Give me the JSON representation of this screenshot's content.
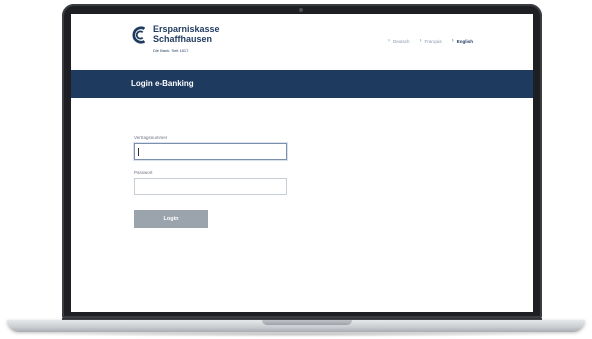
{
  "brand": {
    "name_line1": "Ersparniskasse",
    "name_line2": "Schaffhausen",
    "tagline": "Die Bank. Seit 1817."
  },
  "languages": [
    {
      "label": "Deutsch",
      "active": false
    },
    {
      "label": "Français",
      "active": false
    },
    {
      "label": "English",
      "active": true
    }
  ],
  "banner": {
    "title": "Login e-Banking"
  },
  "form": {
    "contract_label": "Vertragsnummer",
    "contract_value": "",
    "password_label": "Passwort",
    "password_value": "",
    "submit_label": "Login"
  },
  "colors": {
    "brand_blue": "#1f3a5f",
    "button_gray": "#9ba3ad",
    "frame": "#1d1f22"
  },
  "icons": {
    "logo": "esh-logo-icon",
    "chevron": "chevron-right-icon"
  }
}
